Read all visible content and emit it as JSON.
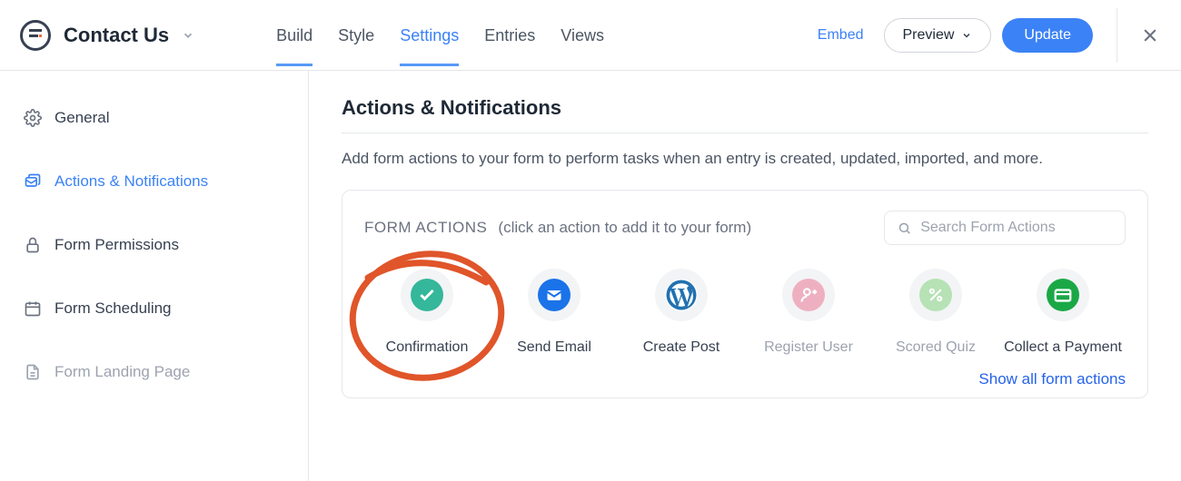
{
  "header": {
    "title": "Contact Us",
    "nav": {
      "build": "Build",
      "style": "Style",
      "settings": "Settings",
      "entries": "Entries",
      "views": "Views"
    },
    "embed": "Embed",
    "preview": "Preview",
    "update": "Update"
  },
  "sidebar": {
    "general": "General",
    "actions": "Actions & Notifications",
    "permissions": "Form Permissions",
    "scheduling": "Form Scheduling",
    "landing": "Form Landing Page"
  },
  "main": {
    "heading": "Actions & Notifications",
    "description": "Add form actions to your form to perform tasks when an entry is created, updated, imported, and more.",
    "box_title": "FORM ACTIONS",
    "box_hint": "(click an action to add it to your form)",
    "search_placeholder": "Search Form Actions",
    "actions": {
      "confirmation": "Confirmation",
      "send_email": "Send Email",
      "create_post": "Create Post",
      "register_user": "Register User",
      "scored_quiz": "Scored Quiz",
      "collect_payment": "Collect a Payment"
    },
    "show_all": "Show all form actions"
  }
}
